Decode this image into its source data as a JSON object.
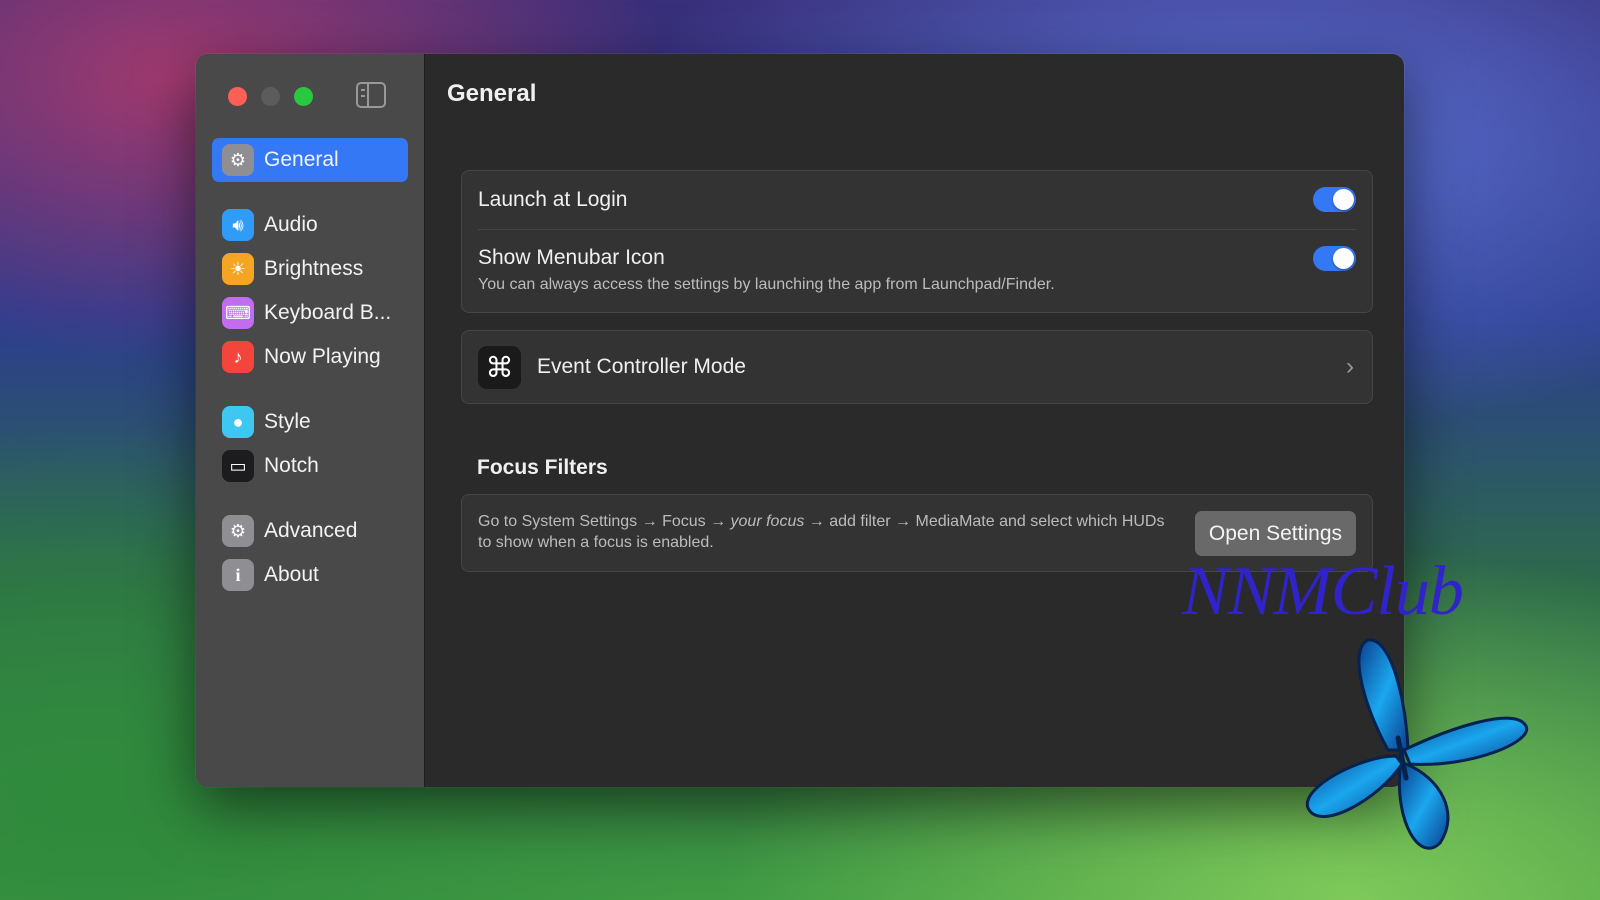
{
  "window": {
    "title": "General"
  },
  "sidebar": {
    "items": [
      {
        "label": "General",
        "icon": "gear-icon",
        "color": "#8e8e93",
        "active": true
      },
      {
        "label": "Audio",
        "icon": "speaker-icon",
        "color": "#2f9cf7",
        "active": false
      },
      {
        "label": "Brightness",
        "icon": "sun-icon",
        "color": "#f5a524",
        "active": false
      },
      {
        "label": "Keyboard B...",
        "icon": "keyboard-icon",
        "color": "#c26cf0",
        "active": false
      },
      {
        "label": "Now Playing",
        "icon": "music-note-icon",
        "color": "#f4453c",
        "active": false
      },
      {
        "label": "Style",
        "icon": "palette-icon",
        "color": "#3ec7f0",
        "active": false
      },
      {
        "label": "Notch",
        "icon": "display-icon",
        "color": "#1c1c1e",
        "active": false
      },
      {
        "label": "Advanced",
        "icon": "gears-icon",
        "color": "#8e8e93",
        "active": false
      },
      {
        "label": "About",
        "icon": "info-icon",
        "color": "#8e8e93",
        "active": false
      }
    ]
  },
  "settings": {
    "launch_at_login": {
      "label": "Launch at Login",
      "enabled": true
    },
    "show_menubar_icon": {
      "label": "Show Menubar Icon",
      "description": "You can always access the settings by launching the app from Launchpad/Finder.",
      "enabled": true
    },
    "event_controller": {
      "label": "Event Controller Mode",
      "icon": "command-icon"
    }
  },
  "focus_filters": {
    "title": "Focus Filters",
    "text_before": "Go to System Settings → Focus → ",
    "text_italic": "your focus",
    "text_after": " → add filter → MediaMate and select which HUDs to show when a focus is enabled.",
    "button_label": "Open Settings"
  },
  "watermark": "NNMClub",
  "colors": {
    "accent": "#3478f6",
    "window_bg": "#2b2a2a",
    "sidebar_bg": "#4a4949"
  }
}
